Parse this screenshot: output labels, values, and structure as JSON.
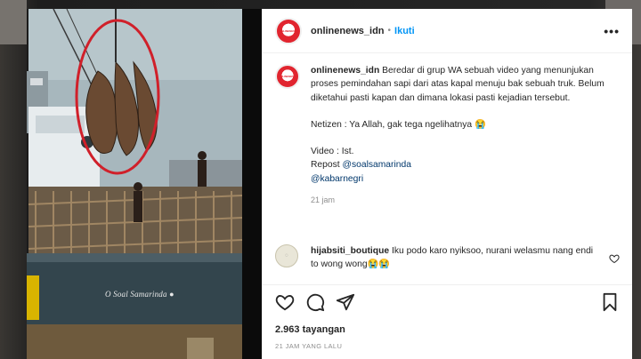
{
  "post": {
    "username": "onlinenews_idn",
    "follow_label": "Ikuti",
    "more_label": "•••",
    "avatar_text": "ONLINENEWS",
    "caption": {
      "username": "onlinenews_idn",
      "text": "Beredar di grup WA sebuah video yang menunjukan proses pemindahan sapi dari atas kapal menuju bak sebuah truk. Belum diketahui pasti kapan dan dimana lokasi pasti kejadian tersebut.",
      "netizen": "Netizen : Ya Allah, gak tega ngelihatnya 😭",
      "video_credit": "Video : Ist.",
      "repost_prefix": "Repost",
      "repost_link": "@soalsamarinda",
      "second_link": "@kabarnegri",
      "time": "21 jam"
    },
    "comment": {
      "username": "hijabsiti_boutique",
      "text": "Iku podo karo nyiksoo, nurani welasmu nang endi to wong wong😭😭"
    },
    "views": "2.963 tayangan",
    "date": "21 JAM YANG LALU",
    "media_watermark": "O Soal Samarinda ●"
  },
  "colors": {
    "accent": "#0095f6",
    "brand_red": "#e1252f",
    "highlight_circle": "#d0202a"
  },
  "icons": {
    "like": "heart-icon",
    "comment": "comment-icon",
    "share": "share-icon",
    "save": "bookmark-icon",
    "more": "more-icon"
  }
}
